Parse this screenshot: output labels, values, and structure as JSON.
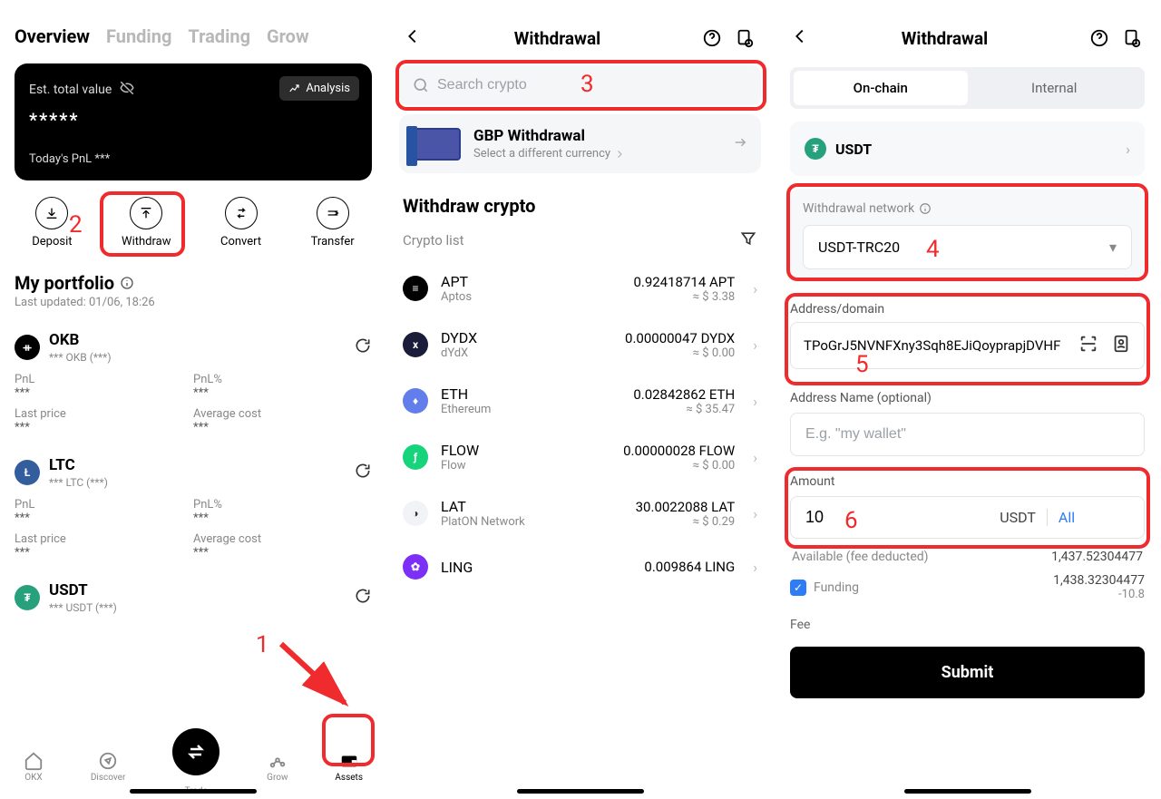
{
  "accent_red": "#ef2b2d",
  "panel1": {
    "tabs": [
      "Overview",
      "Funding",
      "Trading",
      "Grow"
    ],
    "est_label": "Est. total value",
    "analysis": "Analysis",
    "masked_value": "*****",
    "today_pnl_label": "Today's PnL ",
    "today_pnl_value": "***",
    "actions": {
      "deposit": "Deposit",
      "withdraw": "Withdraw",
      "convert": "Convert",
      "transfer": "Transfer"
    },
    "portfolio_title": "My portfolio",
    "updated_label": "Last updated: 01/06, 18:26",
    "fields": {
      "pnl": "PnL",
      "pnlp": "PnL%",
      "lp": "Last price",
      "ac": "Average cost"
    },
    "dots": "***",
    "assets": [
      {
        "code": "OKB",
        "sub": "*** OKB  (***)"
      },
      {
        "code": "LTC",
        "sub": "*** LTC  (***)"
      },
      {
        "code": "USDT",
        "sub": "*** USDT  (***)"
      }
    ],
    "nav": {
      "okx": "OKX",
      "discover": "Discover",
      "trade": "Trade",
      "grow": "Grow",
      "assets": "Assets"
    },
    "annotations": {
      "one": "1",
      "two": "2"
    }
  },
  "panel2": {
    "title": "Withdrawal",
    "search_placeholder": "Search crypto",
    "annotation": "3",
    "gbp": {
      "title": "GBP Withdrawal",
      "sub": "Select a different currency"
    },
    "withdraw_title": "Withdraw crypto",
    "crypto_list_label": "Crypto list",
    "items": [
      {
        "sym": "APT",
        "name": "Aptos",
        "bal": "0.92418714 APT",
        "usd": "≈ $ 3.38",
        "color": "#000"
      },
      {
        "sym": "DYDX",
        "name": "dYdX",
        "bal": "0.00000047 DYDX",
        "usd": "≈ $ 0.00",
        "color": "#1b1b3a"
      },
      {
        "sym": "ETH",
        "name": "Ethereum",
        "bal": "0.02842862 ETH",
        "usd": "≈ $ 35.47",
        "color": "#627eea"
      },
      {
        "sym": "FLOW",
        "name": "Flow",
        "bal": "0.00000028 FLOW",
        "usd": "≈ $ 0.00",
        "color": "#16d47b"
      },
      {
        "sym": "LAT",
        "name": "PlatON Network",
        "bal": "30.0022088 LAT",
        "usd": "≈ $ 0.29",
        "color": "#eef"
      },
      {
        "sym": "LING",
        "name": "",
        "bal": "0.009864 LING",
        "usd": "",
        "color": "#7b2ff7"
      }
    ]
  },
  "panel3": {
    "title": "Withdrawal",
    "seg": {
      "onchain": "On-chain",
      "internal": "Internal"
    },
    "coin": "USDT",
    "network_label": "Withdrawal network",
    "network_value": "USDT-TRC20",
    "addr_label": "Address/domain",
    "addr_value": "TPoGrJ5NVNFXny3Sqh8EJiQoyprapjDVHF",
    "addr_name_label": "Address Name (optional)",
    "addr_name_placeholder": "E.g. \"my wallet\"",
    "amount_label": "Amount",
    "amount_value": "10",
    "amount_unit": "USDT",
    "amount_all": "All",
    "available_label": "Available (fee deducted)",
    "available_value": "1,437.52304477",
    "funding_label": "Funding",
    "funding_value": "1,438.32304477",
    "funding_delta": "-10.8",
    "fee_label": "Fee",
    "submit": "Submit",
    "annotations": {
      "four": "4",
      "five": "5",
      "six": "6"
    }
  }
}
